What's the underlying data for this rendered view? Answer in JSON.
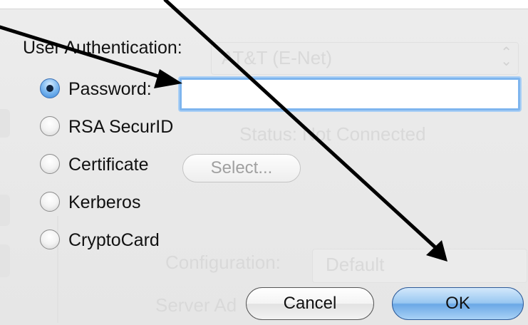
{
  "dialog": {
    "heading": "User Authentication:",
    "options": [
      {
        "label": "Password:",
        "selected": true
      },
      {
        "label": "RSA SecurID",
        "selected": false
      },
      {
        "label": "Certificate",
        "selected": false
      },
      {
        "label": "Kerberos",
        "selected": false
      },
      {
        "label": "CryptoCard",
        "selected": false
      }
    ],
    "password_value": "",
    "select_label": "Select...",
    "cancel_label": "Cancel",
    "ok_label": "OK"
  },
  "background": {
    "vpn_name": "AT&T (E-Net)",
    "status": "Status: Not Connected",
    "configuration_label": "Configuration:",
    "configuration_value": "Default",
    "server_label": "Server Ad"
  },
  "colors": {
    "accent_blue": "#6aa8e6",
    "focus_ring": "#7eb5ee",
    "annotation_arrow": "#000000"
  }
}
